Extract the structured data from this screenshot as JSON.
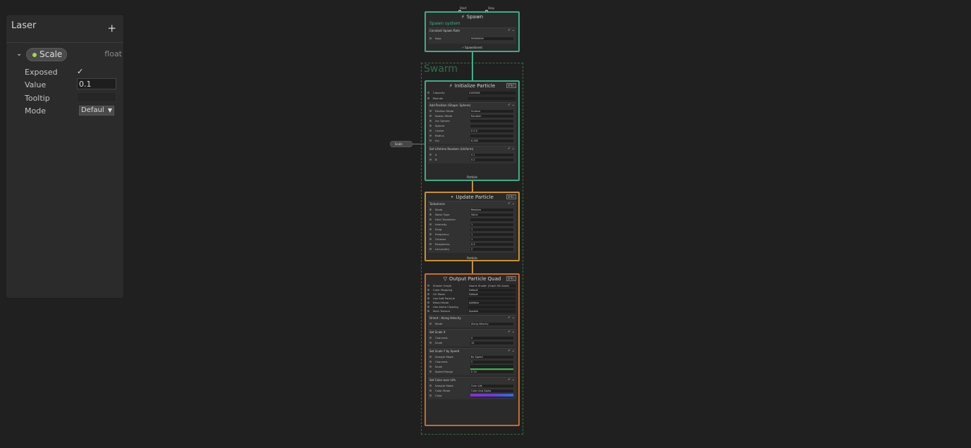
{
  "blackboard": {
    "title": "Laser",
    "add_label": "+",
    "property": {
      "name": "Scale",
      "type": "float",
      "color": "#a3d94a"
    },
    "fields": {
      "exposed_label": "Exposed",
      "exposed_checked": true,
      "value_label": "Value",
      "value": "0.1",
      "tooltip_label": "Tooltip",
      "tooltip": "",
      "mode_label": "Mode",
      "mode": "Defaul"
    }
  },
  "graph": {
    "group_label": "Swarm",
    "top_ports": [
      "Start",
      "Stop"
    ],
    "scale_node": "Scale",
    "spawn": {
      "title": "Spawn",
      "system_name": "Spawn system",
      "block": "Constant Spawn Rate",
      "rows": [
        {
          "label": "Rate",
          "value": "99999999"
        }
      ],
      "footer": "SpawnEvent"
    },
    "initialize": {
      "title": "Initialize Particle",
      "badge": "SPEC",
      "rows": [
        {
          "label": "Capacity",
          "value": "4161646"
        },
        {
          "label": "Bounds",
          "value": ""
        }
      ],
      "blocks": [
        {
          "title": "Add Position (Shape: Sphere)",
          "rows": [
            {
              "label": "Position Mode",
              "value": "Surface"
            },
            {
              "label": "Spawn Mode",
              "value": "Random"
            },
            {
              "label": "Arc Sphere",
              "value": ""
            },
            {
              "label": "Sphere",
              "value": ""
            },
            {
              "label": "Center",
              "value": "0     0     0"
            },
            {
              "label": "Radius",
              "value": ""
            },
            {
              "label": "Arc",
              "value": "6.283"
            }
          ]
        },
        {
          "title": "Set Lifetime Random (Uniform)",
          "rows": [
            {
              "label": "A",
              "value": "0.1"
            },
            {
              "label": "B",
              "value": "0.2"
            }
          ]
        }
      ],
      "footer": "Particle"
    },
    "update": {
      "title": "Update Particle",
      "badge": "SPEC",
      "blocks": [
        {
          "title": "Turbulence",
          "rows": [
            {
              "label": "Mode",
              "value": "Relative"
            },
            {
              "label": "Noise Type",
              "value": "Value"
            },
            {
              "label": "Field Transform",
              "value": ""
            },
            {
              "label": "Intensity",
              "value": "1"
            },
            {
              "label": "Drag",
              "value": "1"
            },
            {
              "label": "Frequency",
              "value": "1"
            },
            {
              "label": "Octaves",
              "value": "1"
            },
            {
              "label": "Roughness",
              "value": "0.5"
            },
            {
              "label": "Lacunarity",
              "value": "2"
            }
          ]
        }
      ],
      "footer": "Particle"
    },
    "output": {
      "title": "Output Particle Quad",
      "badge": "SPEC",
      "rows": [
        {
          "label": "Shader Graph",
          "value": "Swarm Shader (Graph Ski Asset)"
        },
        {
          "label": "Color Mapping",
          "value": "Default"
        },
        {
          "label": "UV Mode",
          "value": "Default"
        },
        {
          "label": "Use Soft Particle",
          "value": ""
        },
        {
          "label": "Blend Mode",
          "value": "Additive"
        },
        {
          "label": "Use Alpha Clipping",
          "value": ""
        },
        {
          "label": "Main Texture",
          "value": "Sparkle"
        }
      ],
      "blocks": [
        {
          "title": "Orient : Along Velocity",
          "rows": [
            {
              "label": "Mode",
              "value": "Along Velocity"
            }
          ]
        },
        {
          "title": "Set Scale X",
          "rows": [
            {
              "label": "Channels",
              "value": "X"
            },
            {
              "label": "Scale",
              "value": "10"
            }
          ]
        },
        {
          "title": "Set Scale Y by Speed",
          "rows": [
            {
              "label": "Sample Mode",
              "value": "By Speed"
            },
            {
              "label": "Channels",
              "value": "Y"
            },
            {
              "label": "Scale",
              "value": ""
            },
            {
              "label": "Speed Range",
              "value": "0     10"
            }
          ]
        },
        {
          "title": "Set Color over Life",
          "rows": [
            {
              "label": "Sample Mode",
              "value": "Over Life"
            },
            {
              "label": "Color Mode",
              "value": "Color And Alpha"
            },
            {
              "label": "Color",
              "value": ""
            }
          ]
        }
      ]
    },
    "colors": {
      "spawn": "#3fae86",
      "init": "#3fae86",
      "update": "#c8912e",
      "output": "#c96b2d",
      "group": "#3a6e3a",
      "curve": "#2fbf3f"
    }
  }
}
